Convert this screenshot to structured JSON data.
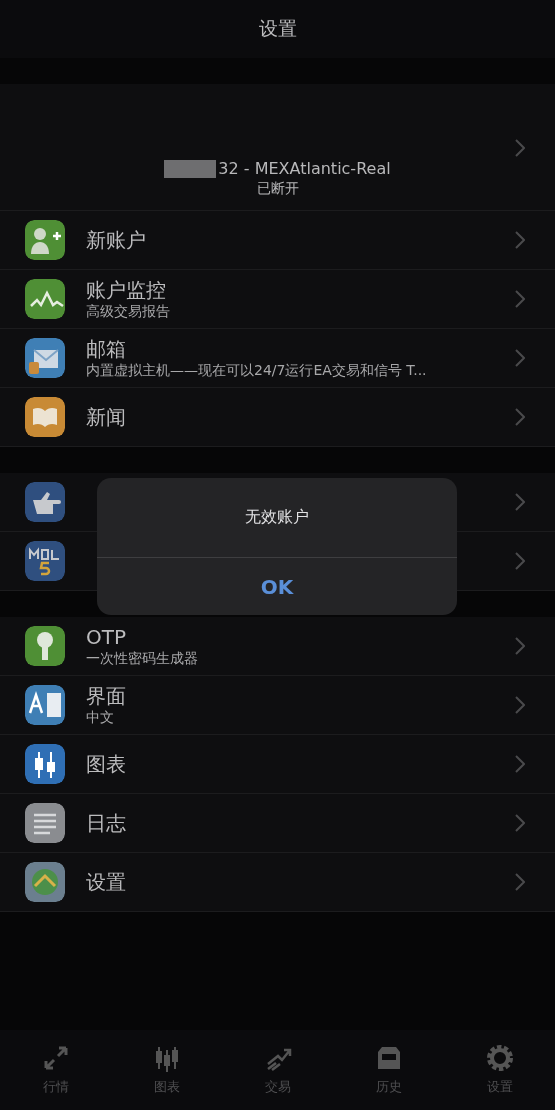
{
  "header": {
    "title": "设置"
  },
  "account": {
    "name": "32 - MEXAtlantic-Real",
    "status": "已断开"
  },
  "groups": [
    {
      "rows": [
        {
          "kind": "user",
          "title": "新账户"
        },
        {
          "kind": "monitor",
          "title": "账户监控",
          "subtitle": "高级交易报告"
        },
        {
          "kind": "mail",
          "title": "邮箱",
          "subtitle": "内置虚拟主机——现在可以24/7运行EA交易和信号  T..."
        },
        {
          "kind": "book",
          "title": "新闻"
        }
      ]
    },
    {
      "rows": [
        {
          "kind": "thumb"
        },
        {
          "kind": "mql"
        }
      ]
    },
    {
      "rows": [
        {
          "kind": "key",
          "title": "OTP",
          "subtitle": "一次性密码生成器"
        },
        {
          "kind": "lang",
          "title": "界面",
          "subtitle": "中文"
        },
        {
          "kind": "candles",
          "title": "图表"
        },
        {
          "kind": "journal",
          "title": "日志"
        },
        {
          "kind": "gear",
          "title": "设置"
        }
      ]
    }
  ],
  "dialog": {
    "message": "无效账户",
    "button": "OK"
  },
  "tabs": [
    {
      "kind": "quotes",
      "label": "行情"
    },
    {
      "kind": "chart",
      "label": "图表"
    },
    {
      "kind": "trade",
      "label": "交易"
    },
    {
      "kind": "history",
      "label": "历史"
    },
    {
      "kind": "settings",
      "label": "设置"
    }
  ]
}
